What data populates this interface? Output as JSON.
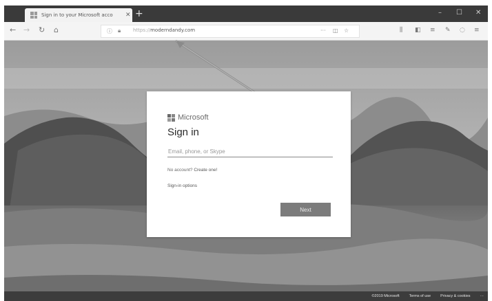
{
  "browser": {
    "tab_title": "Sign in to your Microsoft acco",
    "tab_close": "✕",
    "new_tab": "+",
    "controls": {
      "minimize": "–",
      "maximize": "☐",
      "close": "✕"
    },
    "nav": {
      "back": "←",
      "forward": "→",
      "refresh": "↻",
      "home": "⌂"
    },
    "url_prefix": "https://",
    "url_host": "moderndandy.com",
    "url_actions": {
      "more": "···",
      "pocket": "◫",
      "bookmark": "☆"
    },
    "toolbar_icons": [
      "library-icon",
      "sidebar-icon",
      "reader-icon",
      "extension-icon",
      "account-icon",
      "menu-icon"
    ],
    "toolbar_glyphs": [
      "⫼",
      "◧",
      "≡",
      "✎",
      "◌",
      "≡"
    ]
  },
  "signin": {
    "brand": "Microsoft",
    "heading": "Sign in",
    "email_placeholder": "Email, phone, or Skype",
    "no_account_text": "No account?",
    "create_one_label": "Create one!",
    "sign_in_options_label": "Sign-in options",
    "next_label": "Next"
  },
  "footer": {
    "copyright": "©2019 Microsoft",
    "terms": "Terms of use",
    "privacy": "Privacy & cookies",
    "more": "···"
  }
}
